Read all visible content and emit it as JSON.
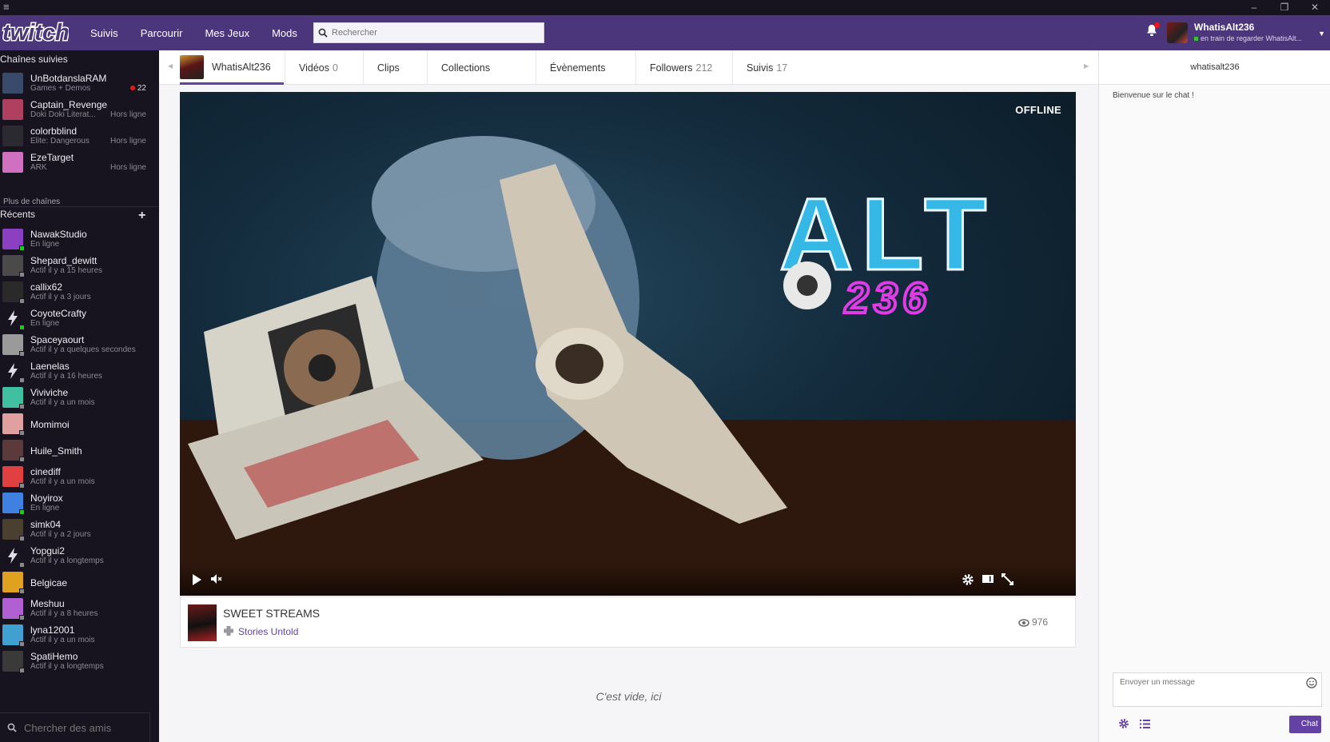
{
  "window": {
    "menu_icon": "hamburger-icon",
    "controls": [
      "–",
      "❐",
      "✕"
    ]
  },
  "topnav": {
    "logo": "twitch",
    "links": [
      "Suivis",
      "Parcourir",
      "Mes Jeux",
      "Mods"
    ],
    "search_placeholder": "Rechercher",
    "user": {
      "name": "WhatisAlt236",
      "status": "en train de regarder WhatisAlt..."
    }
  },
  "sidebar": {
    "followed_title": "Chaînes suivies",
    "followed": [
      {
        "name": "UnBotdanslaRAM",
        "sub": "Games + Demos",
        "live_count": "22",
        "color": "#3a4a6a"
      },
      {
        "name": "Captain_Revenge",
        "sub": "Doki Doki Literat...",
        "status": "Hors ligne",
        "color": "#b04060"
      },
      {
        "name": "colorbblind",
        "sub": "Elite: Dangerous",
        "status": "Hors ligne",
        "color": "#2a2a30"
      },
      {
        "name": "EzeTarget",
        "sub": "ARK",
        "status": "Hors ligne",
        "color": "#d070c0"
      }
    ],
    "more_channels": "Plus de chaînes",
    "recent_title": "Récents",
    "recent": [
      {
        "name": "NawakStudio",
        "sub": "En ligne",
        "color": "#8a40c0",
        "online": true
      },
      {
        "name": "Shepard_dewitt",
        "sub": "Actif il y a 15 heures",
        "color": "#4a4a4a"
      },
      {
        "name": "callix62",
        "sub": "Actif il y a 3 jours",
        "color": "#2a2a2a"
      },
      {
        "name": "CoyoteCrafty",
        "sub": "En ligne",
        "color": "#17141f",
        "online": true,
        "bolt": true
      },
      {
        "name": "Spaceyaourt",
        "sub": "Actif il y a quelques secondes",
        "color": "#9a9a9a"
      },
      {
        "name": "Laenelas",
        "sub": "Actif il y a 16 heures",
        "color": "#17141f",
        "bolt": true
      },
      {
        "name": "Viviviche",
        "sub": "Actif il y a un mois",
        "color": "#40c0a0"
      },
      {
        "name": "Momimoi",
        "sub": "",
        "color": "#e0a0a0"
      },
      {
        "name": "Huile_Smith",
        "sub": "",
        "color": "#5a3a3a"
      },
      {
        "name": "cinediff",
        "sub": "Actif il y a un mois",
        "color": "#e04040"
      },
      {
        "name": "Noyirox",
        "sub": "En ligne",
        "color": "#4080e0",
        "online": true
      },
      {
        "name": "simk04",
        "sub": "Actif il y a 2 jours",
        "color": "#4a4030"
      },
      {
        "name": "Yopgui2",
        "sub": "Actif il y a longtemps",
        "color": "#17141f",
        "bolt": true
      },
      {
        "name": "Belgicae",
        "sub": "",
        "color": "#e0a020"
      },
      {
        "name": "Meshuu",
        "sub": "Actif il y a 8 heures",
        "color": "#b060d0"
      },
      {
        "name": "lyna12001",
        "sub": "Actif il y a un mois",
        "color": "#40a0d0"
      },
      {
        "name": "SpatiHemo",
        "sub": "Actif il y a longtemps",
        "color": "#3a3a3a"
      }
    ],
    "friends_placeholder": "Chercher des amis"
  },
  "channel": {
    "name": "WhatisAlt236",
    "tabs": [
      {
        "label": "Vidéos",
        "count": "0"
      },
      {
        "label": "Clips",
        "count": ""
      },
      {
        "label": "Collections",
        "count": ""
      },
      {
        "label": "Évènements",
        "count": ""
      },
      {
        "label": "Followers",
        "count": "212"
      },
      {
        "label": "Suivis",
        "count": "17"
      }
    ]
  },
  "player": {
    "status": "OFFLINE",
    "logo_text": "ALT",
    "logo_sub": "236"
  },
  "info": {
    "title": "SWEET STREAMS",
    "game": "Stories Untold",
    "views": "976"
  },
  "empty_text": "C'est vide, ici",
  "chat": {
    "header": "whatisalt236",
    "welcome": "Bienvenue sur le chat !",
    "placeholder": "Envoyer un message",
    "button": "Chat"
  },
  "colors": {
    "brand": "#6441a4",
    "nav": "#4b367c",
    "sidebar": "#17141f"
  }
}
